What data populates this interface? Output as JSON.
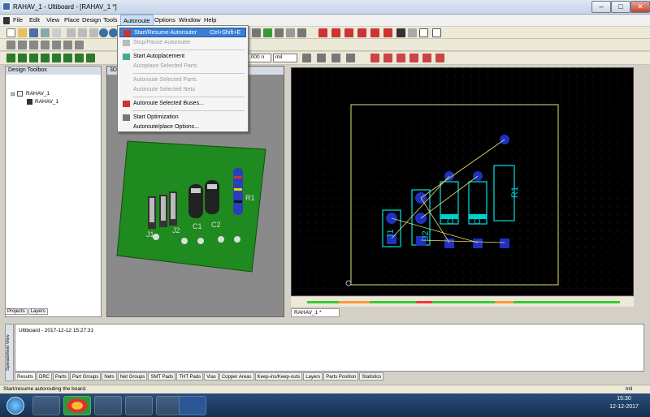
{
  "window": {
    "title": "RAHAV_1 - Ultiboard - [RAHAV_1 *]",
    "min": "–",
    "max": "□",
    "close": "✕"
  },
  "menu": [
    "File",
    "Edit",
    "View",
    "Place",
    "Design",
    "Tools",
    "Autoroute",
    "Options",
    "Window",
    "Help"
  ],
  "toolbar": {
    "zoom_value": ".000 n",
    "unit_value": "mil"
  },
  "autoroute_menu": {
    "items": [
      {
        "label": "Start/Resume Autorouter",
        "shortcut": "Ctrl+Shift+E",
        "state": "highlighted"
      },
      {
        "label": "Stop/Pause Autorouter",
        "state": "disabled"
      },
      {
        "label": "Start Autoplacement",
        "state": "enabled"
      },
      {
        "label": "Autoplace Selected Parts",
        "state": "disabled"
      },
      {
        "label": "Autoroute Selected Parts",
        "state": "disabled"
      },
      {
        "label": "Autoroute Selected Nets",
        "state": "disabled"
      },
      {
        "label": "Autoroute Selected Buses...",
        "state": "enabled"
      },
      {
        "label": "Start Optimization",
        "state": "enabled"
      },
      {
        "label": "Autoroute/place Options...",
        "state": "enabled"
      }
    ]
  },
  "toolbox": {
    "title": "Design Toolbox",
    "root": "RAHAV_1",
    "child": "RAHAV_1",
    "tabs": [
      "Projects",
      "Layers"
    ]
  },
  "view3d": {
    "title": "3D vi"
  },
  "pcb": {
    "parts": [
      "J1",
      "J2",
      "C1",
      "C2",
      "R1"
    ],
    "doc_tab": "RAHAV_1 *"
  },
  "output": {
    "line": "Ultiboard  -  2017-12-12 15:27:31",
    "side_label": "Spreadsheet View"
  },
  "bottom_tabs": [
    "Results",
    "DRC",
    "Parts",
    "Part Groups",
    "Nets",
    "Net Groups",
    "SMT Pads",
    "THT Pads",
    "Vias",
    "Copper Areas",
    "Keep-ins/Keep-outs",
    "Layers",
    "Parts Position",
    "Statistics"
  ],
  "status": {
    "text": "Start/resume autorouting the board.",
    "unit": "mil"
  },
  "taskbar": {
    "time": "15:30",
    "date": "12-12-2017"
  },
  "colors": {
    "accent": "#3a7fd5",
    "board_outline": "#e8e070",
    "pads": "#2030c0",
    "silk": "#00d0d0",
    "ratsnest": "#e8e070",
    "pcb_green": "#1f8a1f"
  }
}
